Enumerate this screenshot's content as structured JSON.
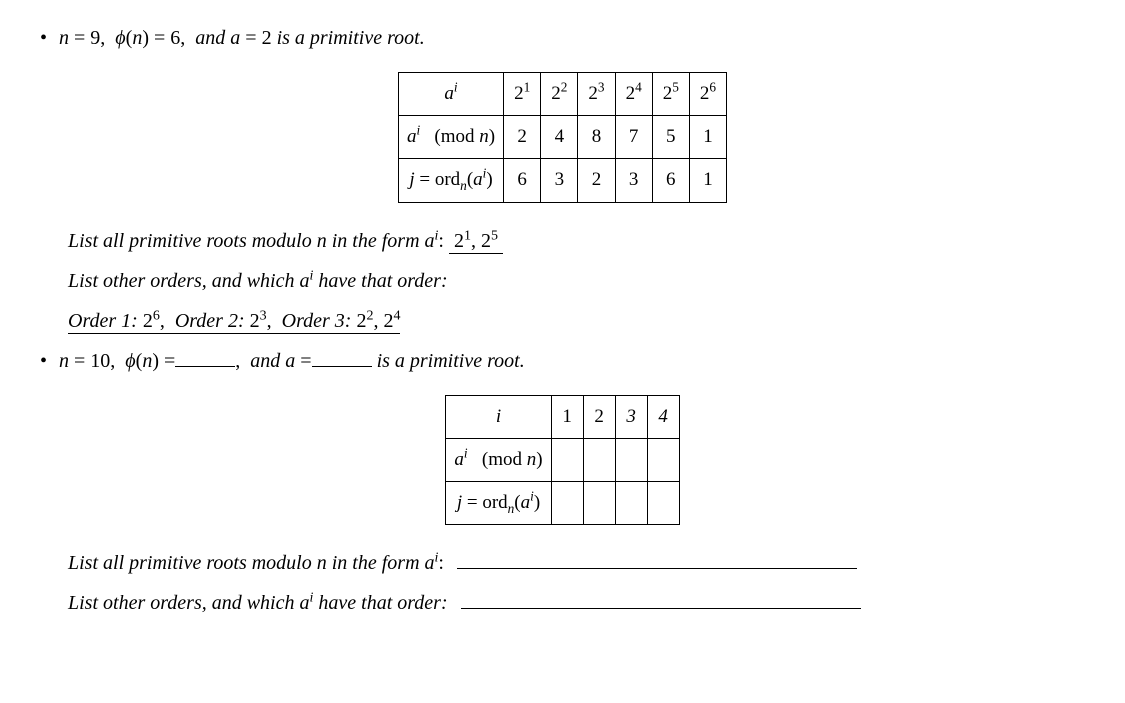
{
  "item1": {
    "heading_prefix": "n",
    "heading_n": "9",
    "phi": "6",
    "a": "2",
    "heading_suffix": "is a primitive root.",
    "table": {
      "row1": {
        "label": "aⁱ",
        "c1": "2¹",
        "c2": "2²",
        "c3": "2³",
        "c4": "2⁴",
        "c5": "2⁵",
        "c6": "2⁶"
      },
      "row2": {
        "label": "aⁱ  (mod n)",
        "c1": "2",
        "c2": "4",
        "c3": "8",
        "c4": "7",
        "c5": "5",
        "c6": "1"
      },
      "row3": {
        "label": "j = ordₙ(aⁱ)",
        "c1": "6",
        "c2": "3",
        "c3": "2",
        "c4": "3",
        "c5": "6",
        "c6": "1"
      }
    },
    "list_primitive_label": "List all primitive roots modulo n in the form aⁱ:",
    "list_primitive_answer": "2¹, 2⁵",
    "list_other_label": "List other orders, and which aⁱ have that order:",
    "list_other_answer": "Order 1: 2⁶,  Order 2: 2³,  Order 3: 2², 2⁴"
  },
  "item2": {
    "heading_n": "10",
    "heading_suffix": "is a primitive root.",
    "table": {
      "row1": {
        "label": "i",
        "c1": "1",
        "c2": "2",
        "c3": "3",
        "c4": "4"
      },
      "row2": {
        "label": "aⁱ  (mod n)"
      },
      "row3": {
        "label": "j = ordₙ(aⁱ)"
      }
    },
    "list_primitive_label": "List all primitive roots modulo n in the form aⁱ:",
    "list_other_label": "List other orders, and which aⁱ have that order:"
  }
}
